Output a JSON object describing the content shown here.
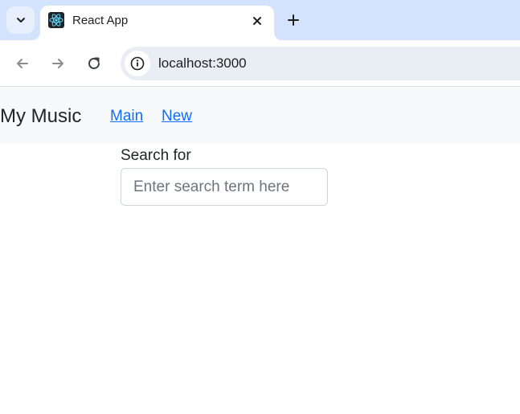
{
  "browser": {
    "tab": {
      "title": "React App",
      "favicon": "react-logo-icon"
    },
    "toolbar": {
      "url": "localhost:3000"
    },
    "icons": {
      "tab_search": "chevron-down-icon",
      "tab_close": "close-icon",
      "new_tab": "plus-icon",
      "back": "arrow-left-icon",
      "forward": "arrow-right-icon",
      "reload": "reload-icon",
      "site_info": "info-icon"
    }
  },
  "page": {
    "navbar": {
      "brand": "My Music",
      "links": [
        {
          "label": "Main"
        },
        {
          "label": "New"
        }
      ]
    },
    "search": {
      "label": "Search for",
      "placeholder": "Enter search term here",
      "value": ""
    }
  },
  "colors": {
    "tabstrip_bg": "#d3e3fd",
    "omnibox_bg": "#e9edf4",
    "navbar_bg": "#f8f9fa",
    "link": "#0d6efd",
    "react_cyan": "#61dafb"
  }
}
